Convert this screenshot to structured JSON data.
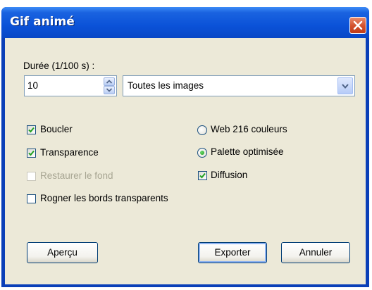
{
  "window": {
    "title": "Gif animé"
  },
  "duration": {
    "label": "Durée (1/100 s) :",
    "value": "10",
    "frames_select": "Toutes les images"
  },
  "options": {
    "loop": {
      "label": "Boucler",
      "checked": true
    },
    "transparency": {
      "label": "Transparence",
      "checked": true
    },
    "restore_background": {
      "label": "Restaurer le fond",
      "checked": false,
      "disabled": true
    },
    "crop_transparent": {
      "label": "Rogner les bords transparents",
      "checked": false
    }
  },
  "palette": {
    "web216": {
      "label": "Web 216 couleurs",
      "selected": false
    },
    "optimized": {
      "label": "Palette optimisée",
      "selected": true
    },
    "diffusion": {
      "label": "Diffusion",
      "checked": true
    }
  },
  "buttons": {
    "preview": "Aperçu",
    "export": "Exporter",
    "cancel": "Annuler"
  },
  "icons": {
    "close": "close-icon",
    "spin_up": "chevron-up-icon",
    "spin_down": "chevron-down-icon",
    "dropdown": "chevron-down-icon",
    "check": "checkmark-icon"
  },
  "colors": {
    "titlebar": "#0b52d8",
    "client": "#ece9d8",
    "border": "#0a3fb8",
    "close": "#d2502c",
    "radio_dot": "#21a121"
  }
}
